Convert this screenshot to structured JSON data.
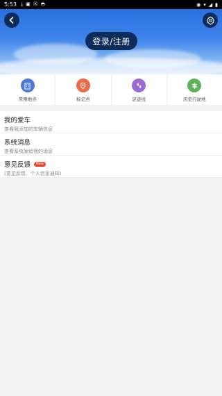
{
  "status_bar": {
    "time": "5:53",
    "left_icons": [
      "download-icon",
      "notification-icon",
      "k-icon",
      "gamepad-icon"
    ],
    "right_icons": [
      "location-icon",
      "wifi-icon",
      "signal-icon",
      "battery-icon"
    ]
  },
  "header": {
    "login_label": "登录/注册"
  },
  "quick": {
    "items": [
      {
        "label": "常用地点",
        "icon": "building-icon",
        "color": "#4a78d8"
      },
      {
        "label": "标记点",
        "icon": "map-pin-icon",
        "color": "#ee6a4a"
      },
      {
        "label": "足迹线",
        "icon": "footprint-icon",
        "color": "#9a6ad9"
      },
      {
        "label": "历史行驶地",
        "icon": "signpost-icon",
        "color": "#5fb25a"
      }
    ]
  },
  "list": {
    "items": [
      {
        "title": "我的爱车",
        "subtitle": "查看我添加的车辆信息"
      },
      {
        "title": "系统消息",
        "subtitle": "查看系统发给我的消息"
      },
      {
        "title": "意见反馈",
        "subtitle": "(意见反馈、个人信息通知)",
        "badge": "New"
      }
    ]
  },
  "colors": {
    "accent_dark": "#0d2c59",
    "badge_red": "#e8462c"
  }
}
